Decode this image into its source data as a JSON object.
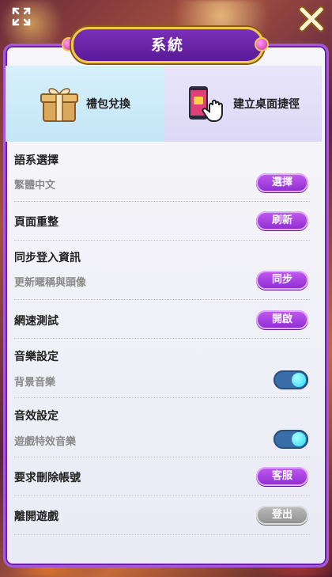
{
  "header": {
    "title": "系統"
  },
  "tabs": [
    {
      "label": "禮包兌換",
      "icon": "gift-box-icon"
    },
    {
      "label": "建立桌面捷徑",
      "icon": "phone-tap-icon"
    }
  ],
  "settings": {
    "language": {
      "label": "語系選擇",
      "value": "繁體中文",
      "button": "選擇"
    },
    "reload": {
      "label": "頁面重整",
      "button": "刷新"
    },
    "sync": {
      "label": "同步登入資訊",
      "sub": "更新暱稱與頭像",
      "button": "同步"
    },
    "speed": {
      "label": "網速測試",
      "button": "開啟"
    },
    "music": {
      "label": "音樂設定",
      "sub": "背景音樂",
      "on": true
    },
    "sfx": {
      "label": "音效設定",
      "sub": "遊戲特效音樂",
      "on": true
    },
    "delete": {
      "label": "要求刪除帳號",
      "button": "客服"
    },
    "exit": {
      "label": "離開遊戲",
      "button": "登出"
    }
  },
  "colors": {
    "accent": "#8a2ad0",
    "frame": "#a35ad8",
    "gold": "#f2c84b",
    "toggle": "#27d8f0"
  }
}
